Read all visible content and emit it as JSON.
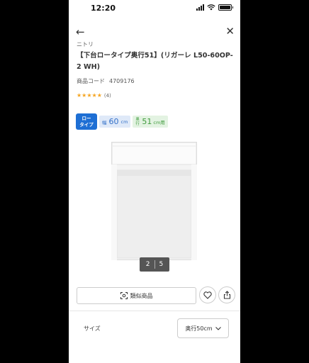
{
  "status_bar": {
    "time": "12:20"
  },
  "nav": {
    "back_icon": "arrow-left-icon",
    "close_icon": "close-icon"
  },
  "product": {
    "brand": "ニトリ",
    "title": "【下台ロータイプ奥行51】(リガーレ L50-60OP-2 WH)",
    "code_label": "商品コード",
    "code_value": "4709176",
    "rating_stars": "★★★★★",
    "rating_count": "(4)",
    "star_color": "#f5a623"
  },
  "tags": {
    "low_type_line1": "ロー",
    "low_type_line2": "タイプ",
    "width_label": "幅",
    "width_value": "60",
    "width_unit": "cm",
    "depth_label_top": "奥",
    "depth_label_bottom": "行",
    "depth_value": "51",
    "depth_unit": "cm用"
  },
  "gallery": {
    "current": "2",
    "total": "5"
  },
  "actions": {
    "similar_label": "類似商品",
    "favorite_icon": "heart-icon",
    "share_icon": "share-icon"
  },
  "size": {
    "label": "サイズ",
    "selected": "奥行50cm"
  }
}
